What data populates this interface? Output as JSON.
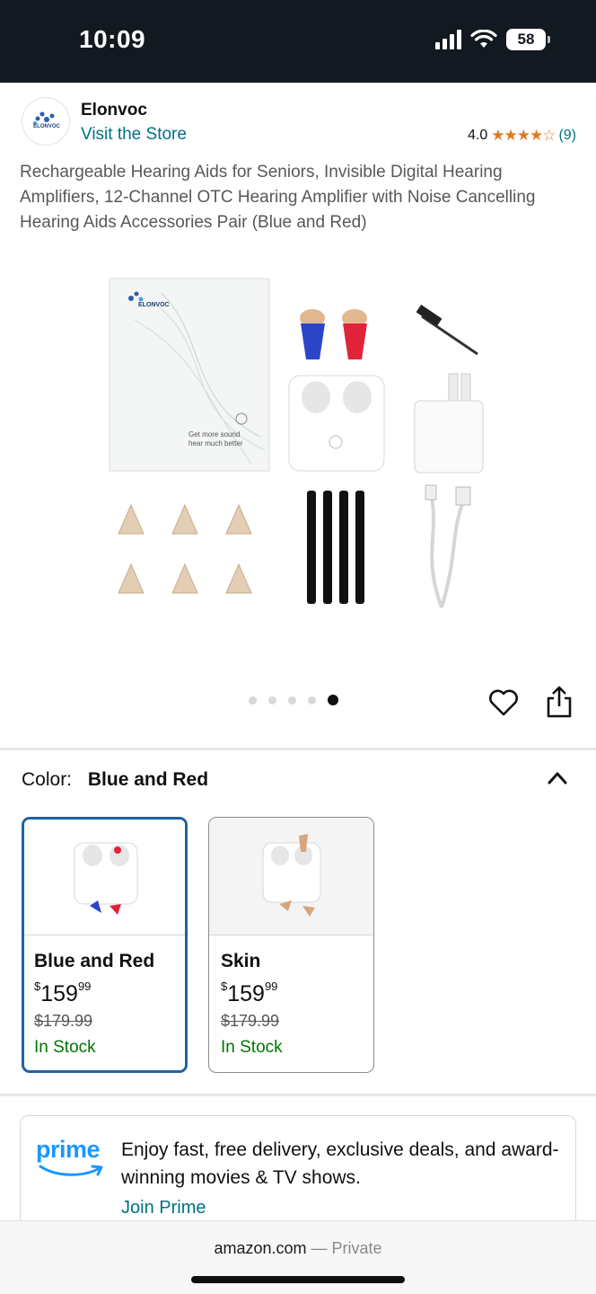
{
  "status_bar": {
    "time": "10:09",
    "battery": "58"
  },
  "store": {
    "name": "Elonvoc",
    "visit_label": "Visit the Store",
    "logo_text": "ELONVOC",
    "rating": "4.0",
    "stars": "★★★★☆",
    "review_count": "(9)"
  },
  "product": {
    "title": "Rechargeable Hearing Aids for Seniors, Invisible Digital Hearing Amplifiers, 12-Channel OTC Hearing Amplifier with Noise Cancelling Hearing Aids Accessories Pair (Blue and Red)",
    "image_text": {
      "brand": "ELONVOC",
      "tagline_1": "Get more sound",
      "tagline_2": "hear much better"
    },
    "carousel": {
      "total": 5,
      "active_index": 4
    }
  },
  "color_selector": {
    "label": "Color:",
    "selected": "Blue and Red",
    "variants": [
      {
        "name": "Blue and Red",
        "price_symbol": "$",
        "price_whole": "159",
        "price_fraction": "99",
        "list_price": "$179.99",
        "stock": "In Stock",
        "selected": true
      },
      {
        "name": "Skin",
        "price_symbol": "$",
        "price_whole": "159",
        "price_fraction": "99",
        "list_price": "$179.99",
        "stock": "In Stock",
        "selected": false
      }
    ]
  },
  "prime": {
    "logo": "prime",
    "text": "Enjoy fast, free delivery, exclusive deals, and award-winning movies & TV shows.",
    "join_label": "Join Prime"
  },
  "browser": {
    "domain": "amazon.com",
    "separator": " — ",
    "mode": "Private"
  },
  "colors": {
    "link": "#007185",
    "star": "#de7921",
    "stock": "#007600",
    "selected_border": "#2162a1",
    "prime": "#1a98ff",
    "status_bar": "#131921"
  }
}
